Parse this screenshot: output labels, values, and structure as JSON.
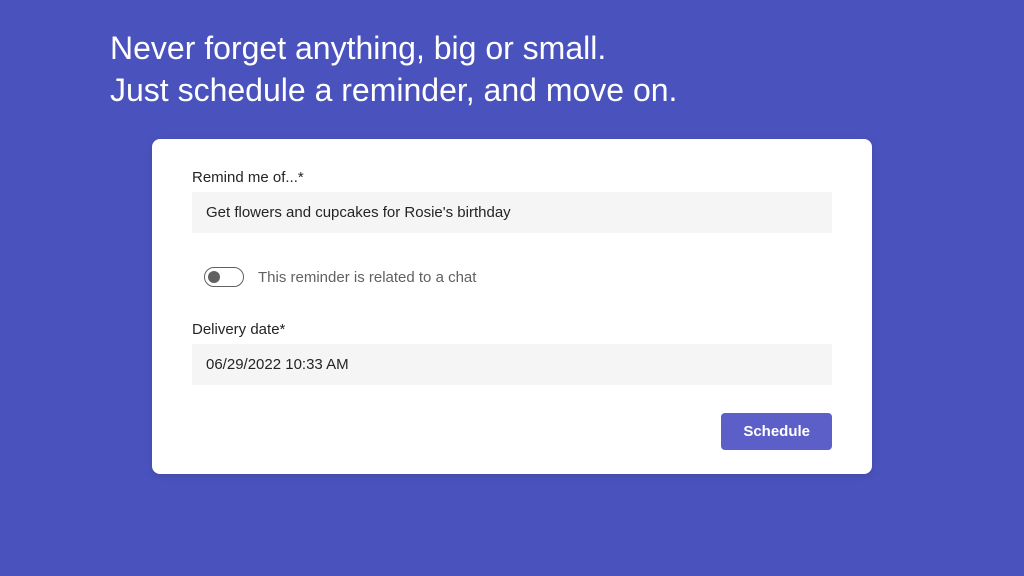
{
  "headline": {
    "line1": "Never forget anything, big or small.",
    "line2": "Just schedule a reminder, and move on."
  },
  "form": {
    "remind_label": "Remind me of...*",
    "remind_value": "Get flowers and cupcakes for Rosie's birthday",
    "toggle_label": "This reminder is related to a chat",
    "toggle_on": false,
    "date_label": "Delivery date*",
    "date_value": "06/29/2022 10:33 AM",
    "schedule_button": "Schedule"
  }
}
